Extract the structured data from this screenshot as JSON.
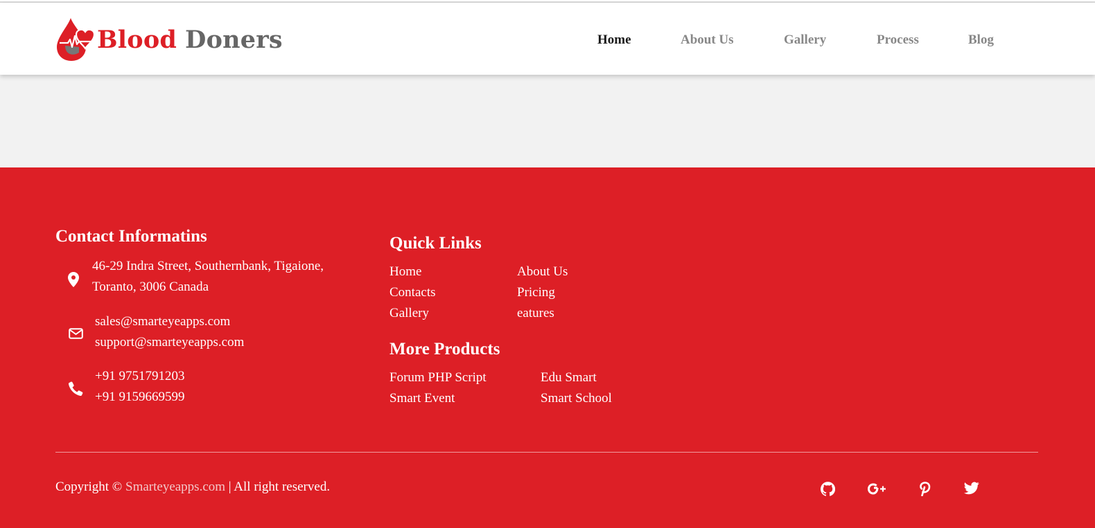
{
  "header": {
    "logo": {
      "word1": "Blood",
      "word2": "Doners",
      "icon": "blood-drop-heart-icon"
    },
    "nav": [
      {
        "label": "Home",
        "active": true
      },
      {
        "label": "About Us",
        "active": false
      },
      {
        "label": "Gallery",
        "active": false
      },
      {
        "label": "Process",
        "active": false
      },
      {
        "label": "Blog",
        "active": false
      }
    ]
  },
  "footer": {
    "contact": {
      "heading": "Contact Informatins",
      "address": {
        "icon": "map-pin-icon",
        "line1": "46-29 Indra Street, Southernbank, Tigaione,",
        "line2": "Toranto, 3006 Canada"
      },
      "email": {
        "icon": "envelope-icon",
        "line1": "sales@smarteyeapps.com",
        "line2": "support@smarteyeapps.com"
      },
      "phone": {
        "icon": "phone-icon",
        "line1": "+91 9751791203",
        "line2": "+91 9159669599"
      }
    },
    "quick_links": {
      "heading": "Quick Links",
      "col1": [
        "Home",
        "Contacts",
        "Gallery"
      ],
      "col2": [
        "About Us",
        "Pricing",
        "eatures"
      ]
    },
    "more_products": {
      "heading": "More Products",
      "col1": [
        "Forum PHP Script",
        "Smart Event"
      ],
      "col2": [
        "Edu Smart",
        "Smart School"
      ]
    },
    "copyright": {
      "prefix": "Copyright ©",
      "brand": "Smarteyeapps.com",
      "suffix": "| All right reserved."
    },
    "social": [
      {
        "icon": "github-icon"
      },
      {
        "icon": "google-plus-icon"
      },
      {
        "icon": "pinterest-icon"
      },
      {
        "icon": "twitter-icon"
      }
    ]
  },
  "colors": {
    "brand_red": "#dd1f26",
    "nav_inactive": "#888888",
    "nav_active": "#1a1a1a",
    "band_grey": "#f2f2f2"
  }
}
